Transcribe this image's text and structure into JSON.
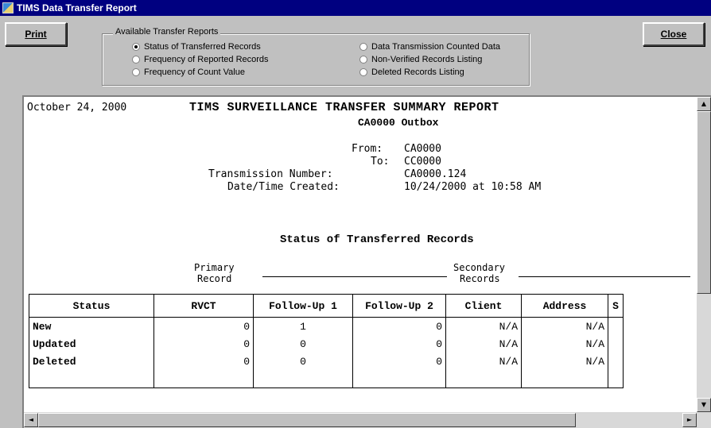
{
  "window": {
    "title": "TIMS Data Transfer Report"
  },
  "buttons": {
    "print": "Print",
    "close": "Close"
  },
  "transfer_reports": {
    "legend": "Available Transfer Reports",
    "options": [
      {
        "label": "Status of Transferred Records",
        "selected": true
      },
      {
        "label": "Frequency of Reported Records",
        "selected": false
      },
      {
        "label": "Frequency of Count Value",
        "selected": false
      },
      {
        "label": "Data Transmission Counted Data",
        "selected": false
      },
      {
        "label": "Non-Verified Records Listing",
        "selected": false
      },
      {
        "label": "Deleted Records Listing",
        "selected": false
      }
    ]
  },
  "report": {
    "date": "October 24, 2000",
    "title": "TIMS SURVEILLANCE TRANSFER SUMMARY REPORT",
    "subtitle": "CA0000 Outbox",
    "from_label": "From:",
    "from_value": "CA0000",
    "to_label": "To:",
    "to_value": "CC0000",
    "transmission_label": "Transmission Number:",
    "transmission_value": "CA0000.124",
    "created_label": "Date/Time Created:",
    "created_value": "10/24/2000 at 10:58 AM",
    "section_title": "Status of Transferred Records",
    "primary_label_1": "Primary",
    "primary_label_2": "Record",
    "secondary_label_1": "Secondary",
    "secondary_label_2": "Records",
    "table": {
      "headers": [
        "Status",
        "RVCT",
        "Follow-Up 1",
        "Follow-Up 2",
        "Client",
        "Address",
        "S"
      ],
      "rows": [
        [
          "New",
          "0",
          "1",
          "0",
          "N/A",
          "N/A"
        ],
        [
          "Updated",
          "0",
          "0",
          "0",
          "N/A",
          "N/A"
        ],
        [
          "Deleted",
          "0",
          "0",
          "0",
          "N/A",
          "N/A"
        ]
      ]
    }
  },
  "scroll": {
    "up": "▲",
    "down": "▼",
    "left": "◄",
    "right": "►"
  }
}
